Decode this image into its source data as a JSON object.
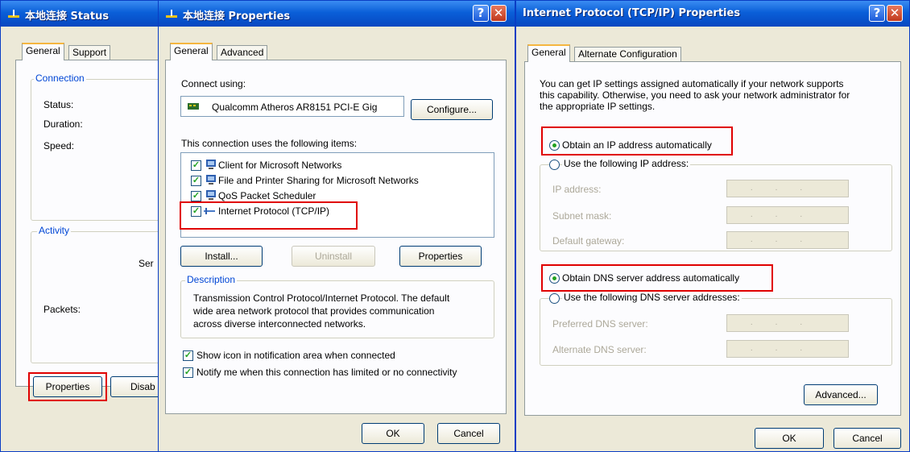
{
  "status_window": {
    "title": "本地连接 Status",
    "tabs": [
      "General",
      "Support"
    ],
    "connection_group": "Connection",
    "status_label": "Status:",
    "duration_label": "Duration:",
    "speed_label": "Speed:",
    "activity_group": "Activity",
    "sent_partial": "Ser",
    "packets_label": "Packets:",
    "properties_button": "Properties",
    "disable_button_partial": "Disab"
  },
  "properties_window": {
    "title": "本地连接 Properties",
    "tabs": [
      "General",
      "Advanced"
    ],
    "connect_using_label": "Connect using:",
    "adapter_name": "Qualcomm Atheros AR8151 PCI-E Gig",
    "configure_button": "Configure...",
    "items_label": "This connection uses the following items:",
    "items": [
      {
        "label": "Client for Microsoft Networks",
        "checked": true
      },
      {
        "label": "File and Printer Sharing for Microsoft Networks",
        "checked": true
      },
      {
        "label": "QoS Packet Scheduler",
        "checked": true
      },
      {
        "label": "Internet Protocol (TCP/IP)",
        "checked": true
      }
    ],
    "install_button": "Install...",
    "uninstall_button": "Uninstall",
    "properties_button": "Properties",
    "description_group": "Description",
    "description_text": [
      "Transmission Control Protocol/Internet Protocol. The default",
      "wide area network protocol that provides communication",
      "across diverse interconnected networks."
    ],
    "show_icon_label": "Show icon in notification area when connected",
    "notify_label": "Notify me when this connection has limited or no connectivity",
    "ok_button": "OK",
    "cancel_button": "Cancel"
  },
  "tcpip_window": {
    "title": "Internet Protocol (TCP/IP) Properties",
    "tabs": [
      "General",
      "Alternate Configuration"
    ],
    "intro_text": [
      "You can get IP settings assigned automatically if your network supports",
      "this capability. Otherwise, you need to ask your network administrator for",
      "the appropriate IP settings."
    ],
    "obtain_ip_auto": "Obtain an IP address automatically",
    "use_following_ip": "Use the following IP address:",
    "ip_address_label": "IP address:",
    "subnet_mask_label": "Subnet mask:",
    "default_gateway_label": "Default gateway:",
    "obtain_dns_auto": "Obtain DNS server address automatically",
    "use_following_dns": "Use the following DNS server addresses:",
    "preferred_dns_label": "Preferred DNS server:",
    "alternate_dns_label": "Alternate DNS server:",
    "advanced_button": "Advanced...",
    "ok_button": "OK",
    "cancel_button": "Cancel"
  },
  "title_buttons": {
    "help": "?",
    "close": "✕"
  },
  "ip_placeholder_dots": "...",
  "colors": {
    "highlight_box": "#e00000",
    "titlebar": "#0a5fd8",
    "dialog_bg": "#ece9d8"
  }
}
